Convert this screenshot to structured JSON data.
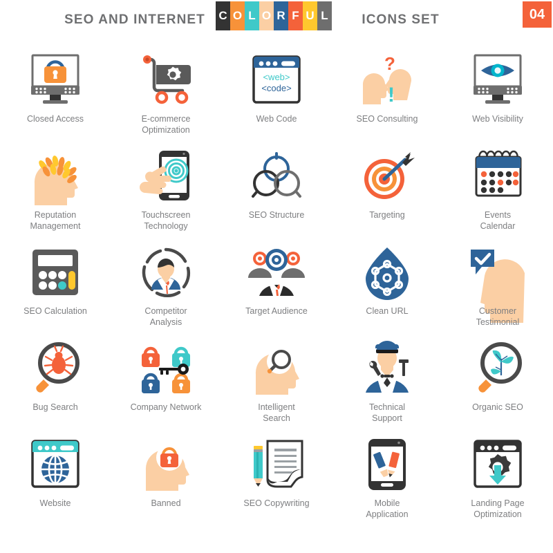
{
  "header": {
    "title_left": "SEO AND INTERNET",
    "title_right": "ICONS SET",
    "badge": "04",
    "colorful": [
      {
        "letter": "C",
        "color": "#333333"
      },
      {
        "letter": "O",
        "color": "#F79239"
      },
      {
        "letter": "L",
        "color": "#3FC9C9"
      },
      {
        "letter": "O",
        "color": "#FBCFA4"
      },
      {
        "letter": "R",
        "color": "#2E6499"
      },
      {
        "letter": "F",
        "color": "#F4623A"
      },
      {
        "letter": "U",
        "color": "#FFC82E"
      },
      {
        "letter": "L",
        "color": "#6E6E6E"
      }
    ]
  },
  "palette": {
    "dark": "#333333",
    "gray": "#6E6E6E",
    "light_gray": "#9AA0A4",
    "orange": "#F4623A",
    "orange_light": "#F79239",
    "yellow": "#FFC82E",
    "teal": "#3FC9C9",
    "blue": "#2E6499",
    "skin": "#FBCFA4",
    "caption_color": "#7d7e80"
  },
  "icons": [
    {
      "id": "closed-access",
      "label": "Closed Access"
    },
    {
      "id": "ecommerce-optimization",
      "label": "E-commerce\nOptimization"
    },
    {
      "id": "web-code",
      "label": "Web Code",
      "screen_line1": "<web>",
      "screen_line2": "<code>"
    },
    {
      "id": "seo-consulting",
      "label": "SEO Consulting"
    },
    {
      "id": "web-visibility",
      "label": "Web Visibility"
    },
    {
      "id": "reputation-management",
      "label": "Reputation\nManagement"
    },
    {
      "id": "touchscreen-technology",
      "label": "Touchscreen\nTechnology"
    },
    {
      "id": "seo-structure",
      "label": "SEO Structure"
    },
    {
      "id": "targeting",
      "label": "Targeting"
    },
    {
      "id": "events-calendar",
      "label": "Events\nCalendar"
    },
    {
      "id": "seo-calculation",
      "label": "SEO Calculation"
    },
    {
      "id": "competitor-analysis",
      "label": "Competitor\nAnalysis"
    },
    {
      "id": "target-audience",
      "label": "Target Audience"
    },
    {
      "id": "clean-url",
      "label": "Clean URL"
    },
    {
      "id": "customer-testimonial",
      "label": "Customer\nTestimonial"
    },
    {
      "id": "bug-search",
      "label": "Bug Search"
    },
    {
      "id": "company-network",
      "label": "Company Network"
    },
    {
      "id": "intelligent-search",
      "label": "Intelligent\nSearch"
    },
    {
      "id": "technical-support",
      "label": "Technical\nSupport"
    },
    {
      "id": "organic-seo",
      "label": "Organic SEO"
    },
    {
      "id": "website",
      "label": "Website"
    },
    {
      "id": "banned",
      "label": "Banned"
    },
    {
      "id": "seo-copywriting",
      "label": "SEO Copywriting"
    },
    {
      "id": "mobile-application",
      "label": "Mobile\nApplication"
    },
    {
      "id": "landing-page-optimization",
      "label": "Landing Page\nOptimization"
    }
  ]
}
